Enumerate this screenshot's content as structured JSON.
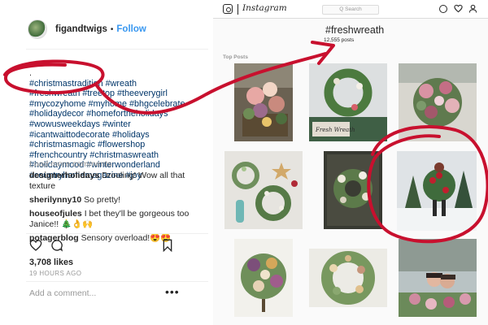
{
  "post": {
    "username": "figandtwigs",
    "separator": "•",
    "follow_label": "Follow",
    "caption_lines": [
      ".",
      "#christmastradition #wreath",
      "#freshwreath #treetop #theeverygirl",
      "#mycozyhome #myhome #bhgcelebrate",
      "#holidaydecor #homefortheholidays",
      "#wowusweekdays #winter",
      "#icantwaittodecorate #holidays",
      "#christmasmagic #flowershop",
      "#frenchcountry #christmaswreath",
      "#holidaymood #winterwonderland",
      "#countryhomemagazine #joy"
    ],
    "load_more_label": "Load more comments",
    "comments": [
      {
        "user": "designerholidays",
        "text": "Drooling! Wow all that texture"
      },
      {
        "user": "sherilynny10",
        "text": "So pretty!"
      },
      {
        "user": "houseofjules",
        "text": "I bet they'll be gorgeous too Janice!! 🎄👌🙌"
      },
      {
        "user": "potagerblog",
        "text": "Sensory overload!😍😍"
      }
    ],
    "likes": "3,708 likes",
    "time_ago": "19 HOURS AGO",
    "add_comment_placeholder": "Add a comment...",
    "more_glyph": "•••",
    "icons": [
      "heart-icon",
      "comment-icon",
      "bookmark-icon",
      "more-options-icon"
    ]
  },
  "hashtag_page": {
    "app_name": "Instagram",
    "search_placeholder": "Q Search",
    "hashtag": "#freshwreath",
    "post_count": "12,555 posts",
    "section_label": "Top Posts",
    "sign_text": "Fresh Wreath",
    "nav_icons": [
      "explore-icon",
      "activity-heart-icon",
      "profile-icon"
    ]
  },
  "annotation": {
    "color": "#c8102e",
    "shapes": [
      "circle-around-hashtag",
      "arrow-to-title",
      "circle-around-post"
    ]
  }
}
